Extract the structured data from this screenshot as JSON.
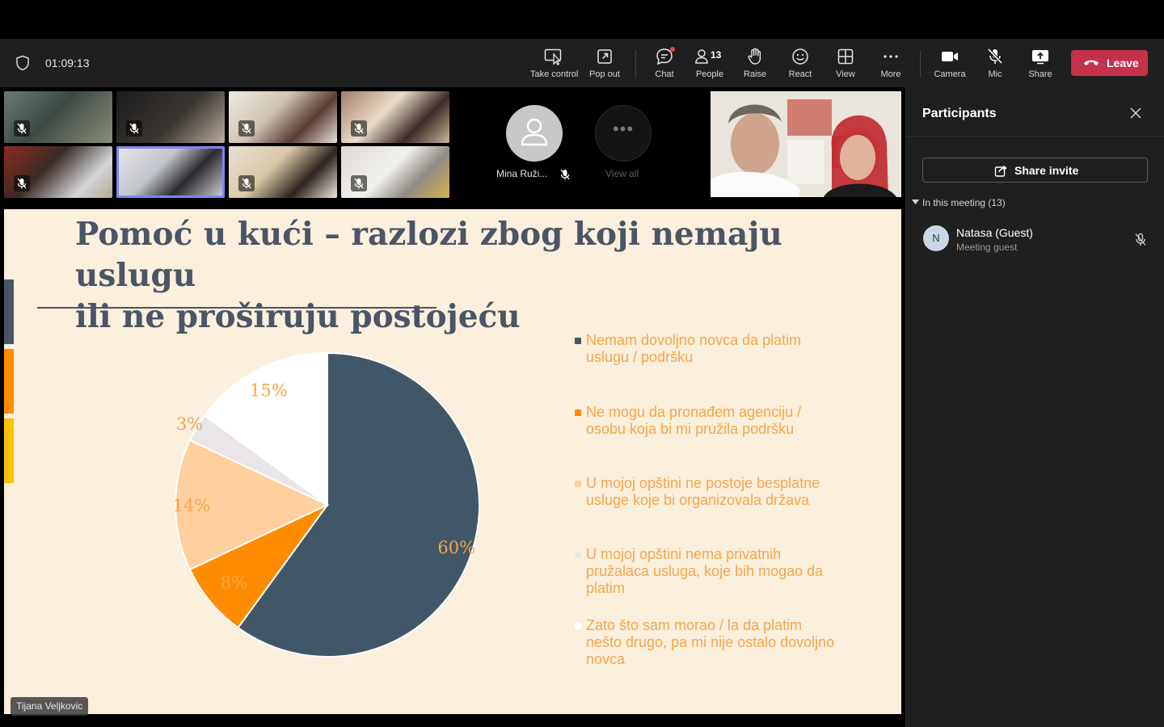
{
  "meeting": {
    "timer": "01:09:13"
  },
  "toolbar": {
    "take_control": "Take control",
    "pop_out": "Pop out",
    "chat": "Chat",
    "people": "People",
    "people_count": "13",
    "raise": "Raise",
    "react": "React",
    "view": "View",
    "more": "More",
    "camera": "Camera",
    "mic": "Mic",
    "share": "Share",
    "leave": "Leave",
    "colors": {
      "leave": "#c4314b",
      "active": "#7f85f5"
    }
  },
  "gallery": {
    "featured_name": "Mina Ruži...",
    "view_all": "View all"
  },
  "slide": {
    "title_line1": "Pomoć u kući – razlozi zbog koji nemaju uslugu",
    "title_line2": "ili ne proširuju postojeću",
    "speaker": "Tijana Veljkovic"
  },
  "chart_data": {
    "type": "pie",
    "slices": [
      {
        "label": "Nemam dovoljno novca da platim uslugu / podršku",
        "value": 60,
        "display": "60%",
        "color": "#415767"
      },
      {
        "label": "Ne mogu da pronađem agenciju / osobu koja bi mi pružila podršku",
        "value": 8,
        "display": "8%",
        "color": "#ff8c00"
      },
      {
        "label": "U mojoj opštini ne postoje besplatne usluge koje bi organizovala država",
        "value": 14,
        "display": "14%",
        "color": "#ffcf9e"
      },
      {
        "label": "U mojoj opštini nema privatnih pružalaca usluga, koje bih mogao da platim",
        "value": 3,
        "display": "3%",
        "color": "#eae6e8"
      },
      {
        "label": "Zato što sam morao / la da platim nešto drugo, pa mi nije ostalo dovoljno novca",
        "value": 15,
        "display": "15%",
        "color": "#ffffff"
      }
    ],
    "legend_position": "right"
  },
  "panel": {
    "title": "Participants",
    "share_invite": "Share invite",
    "section_label": "In this meeting (13)",
    "participants": [
      {
        "initial": "N",
        "name": "Natasa (Guest)",
        "role": "Meeting guest"
      }
    ]
  }
}
